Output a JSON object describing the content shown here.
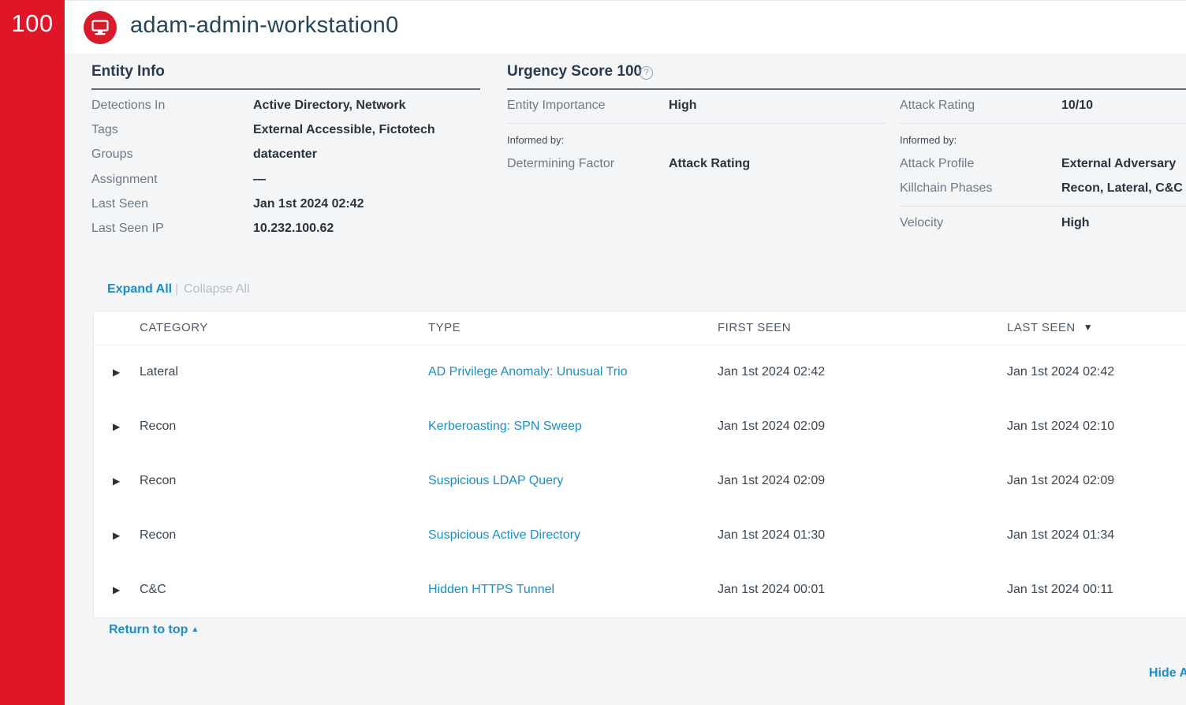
{
  "score_rail": {
    "value": "100",
    "color": "#de1628"
  },
  "header": {
    "title": "adam-admin-workstation0",
    "icon": "monitor-icon"
  },
  "entity_info": {
    "title": "Entity Info",
    "rows": [
      {
        "label": "Detections In",
        "value": "Active Directory, Network"
      },
      {
        "label": "Tags",
        "value": "External Accessible, Fictotech"
      },
      {
        "label": "Groups",
        "value": "datacenter"
      },
      {
        "label": "Assignment",
        "value": "—"
      },
      {
        "label": "Last Seen",
        "value": "Jan 1st 2024 02:42"
      },
      {
        "label": "Last Seen IP",
        "value": "10.232.100.62"
      }
    ]
  },
  "urgency": {
    "title": "Urgency Score 100",
    "help_icon": "?",
    "left": {
      "importance_label": "Entity Importance",
      "importance_value": "High",
      "informed_by": "Informed by:",
      "factor_label": "Determining Factor",
      "factor_value": "Attack Rating"
    },
    "right": {
      "rating_label": "Attack Rating",
      "rating_value": "10/10",
      "informed_by": "Informed by:",
      "profile_label": "Attack Profile",
      "profile_value": "External Adversary",
      "phases_label": "Killchain Phases",
      "phases_value": "Recon, Lateral, C&C",
      "velocity_label": "Velocity",
      "velocity_value": "High"
    }
  },
  "controls": {
    "expand_all": "Expand All",
    "separator": "|",
    "collapse_all": "Collapse All"
  },
  "table": {
    "headers": {
      "category": "CATEGORY",
      "type": "TYPE",
      "first_seen": "FIRST SEEN",
      "last_seen": "LAST SEEN"
    },
    "sort_icon": "▼",
    "toggle_icon": "▶",
    "rows": [
      {
        "category": "Lateral",
        "type": "AD Privilege Anomaly: Unusual Trio",
        "first_seen": "Jan 1st 2024 02:42",
        "last_seen": "Jan 1st 2024 02:42"
      },
      {
        "category": "Recon",
        "type": "Kerberoasting: SPN Sweep",
        "first_seen": "Jan 1st 2024 02:09",
        "last_seen": "Jan 1st 2024 02:10"
      },
      {
        "category": "Recon",
        "type": "Suspicious LDAP Query",
        "first_seen": "Jan 1st 2024 02:09",
        "last_seen": "Jan 1st 2024 02:09"
      },
      {
        "category": "Recon",
        "type": "Suspicious Active Directory",
        "first_seen": "Jan 1st 2024 01:30",
        "last_seen": "Jan 1st 2024 01:34"
      },
      {
        "category": "C&C",
        "type": "Hidden HTTPS Tunnel",
        "first_seen": "Jan 1st 2024 00:01",
        "last_seen": "Jan 1st 2024 00:11"
      }
    ]
  },
  "footer": {
    "return_top": "Return to top",
    "return_caret": "▲",
    "hide": "Hide A"
  }
}
